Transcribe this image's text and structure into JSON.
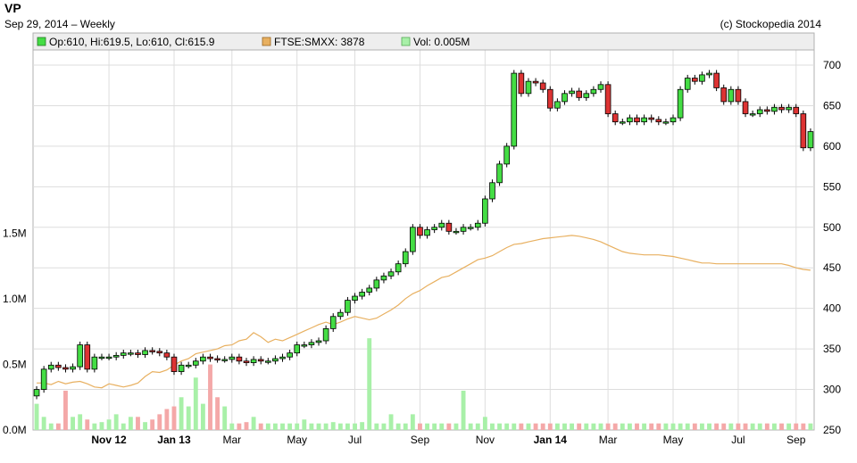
{
  "header": {
    "title": "VP",
    "subtitle": "Sep 29, 2014 – Weekly",
    "copyright": "(c) Stockopedia 2014"
  },
  "legend": {
    "ohlc": "Op:610, Hi:619.5, Lo:610, Cl:615.9",
    "index": "FTSE:SMXX: 3878",
    "volume": "Vol: 0.005M"
  },
  "colors": {
    "up": "#44dd44",
    "down": "#dd3333",
    "index_line": "#e8b060",
    "vol_up": "#a8f0a8",
    "vol_down": "#f4a8a8",
    "grid": "#dddddd",
    "legend_bg": "#eeeeee"
  },
  "chart_data": {
    "type": "candlestick",
    "price_axis": {
      "ylim": [
        250,
        700
      ],
      "ticks": [
        700,
        650,
        600,
        550,
        500,
        450,
        400,
        350,
        300,
        250
      ]
    },
    "volume_axis": {
      "ylim": [
        0,
        2.9
      ],
      "ticks": [
        {
          "value": 1.5,
          "label": "1.5M"
        },
        {
          "value": 1.0,
          "label": "1.0M"
        },
        {
          "value": 0.5,
          "label": "0.5M"
        },
        {
          "value": 0.0,
          "label": "0.0M"
        }
      ]
    },
    "x_ticks": [
      {
        "index": 10,
        "label": "Nov 12",
        "bold": true
      },
      {
        "index": 19,
        "label": "Jan 13",
        "bold": true
      },
      {
        "index": 27,
        "label": "Mar",
        "bold": false
      },
      {
        "index": 36,
        "label": "May",
        "bold": false
      },
      {
        "index": 44,
        "label": "Jul",
        "bold": false
      },
      {
        "index": 53,
        "label": "Sep",
        "bold": false
      },
      {
        "index": 62,
        "label": "Nov",
        "bold": false
      },
      {
        "index": 71,
        "label": "Jan 14",
        "bold": true
      },
      {
        "index": 79,
        "label": "Mar",
        "bold": false
      },
      {
        "index": 88,
        "label": "May",
        "bold": false
      },
      {
        "index": 97,
        "label": "Jul",
        "bold": false
      },
      {
        "index": 105,
        "label": "Sep",
        "bold": false
      }
    ],
    "closes": [
      300,
      325,
      330,
      327,
      325,
      328,
      355,
      325,
      340,
      340,
      340,
      342,
      345,
      345,
      343,
      348,
      347,
      345,
      340,
      322,
      330,
      330,
      335,
      340,
      338,
      337,
      337,
      340,
      335,
      333,
      337,
      335,
      335,
      338,
      340,
      345,
      355,
      355,
      358,
      360,
      375,
      390,
      395,
      410,
      415,
      420,
      425,
      435,
      440,
      445,
      455,
      470,
      500,
      490,
      497,
      500,
      505,
      495,
      495,
      500,
      500,
      505,
      535,
      555,
      578,
      600,
      690,
      665,
      680,
      678,
      670,
      647,
      655,
      665,
      668,
      660,
      665,
      670,
      676,
      640,
      630,
      630,
      635,
      630,
      635,
      633,
      630,
      630,
      635,
      670,
      684,
      680,
      688,
      690,
      672,
      655,
      670,
      655,
      640,
      640,
      645,
      643,
      648,
      645,
      648,
      640,
      598,
      618
    ],
    "index_line": [
      308,
      308,
      306,
      310,
      307,
      309,
      310,
      307,
      303,
      302,
      307,
      305,
      303,
      305,
      308,
      316,
      322,
      321,
      324,
      330,
      335,
      338,
      344,
      346,
      348,
      350,
      354,
      355,
      360,
      362,
      370,
      365,
      358,
      362,
      360,
      364,
      368,
      372,
      376,
      380,
      383,
      380,
      383,
      387,
      390,
      388,
      386,
      388,
      393,
      398,
      404,
      412,
      418,
      422,
      428,
      433,
      438,
      440,
      445,
      450,
      455,
      460,
      462,
      465,
      470,
      475,
      479,
      480,
      482,
      484,
      486,
      487,
      488,
      489,
      490,
      489,
      487,
      485,
      482,
      478,
      474,
      470,
      468,
      467,
      466,
      466,
      466,
      465,
      464,
      462,
      460,
      458,
      456,
      456,
      455,
      455,
      455,
      455,
      455,
      455,
      455,
      455,
      455,
      455,
      453,
      450,
      448,
      447
    ],
    "volume": [
      0.2,
      0.1,
      0.05,
      0.05,
      0.3,
      0.1,
      0.12,
      0.08,
      0.05,
      0.06,
      0.08,
      0.12,
      0.05,
      0.1,
      0.1,
      0.06,
      0.08,
      0.12,
      0.16,
      0.18,
      0.25,
      0.18,
      0.4,
      0.2,
      0.5,
      0.25,
      0.18,
      0.05,
      0.05,
      0.06,
      0.1,
      0.05,
      0.05,
      0.05,
      0.05,
      0.05,
      0.05,
      0.08,
      0.05,
      0.05,
      0.05,
      0.06,
      0.05,
      0.05,
      0.05,
      0.06,
      0.7,
      0.05,
      0.05,
      0.12,
      0.05,
      0.05,
      0.12,
      0.05,
      0.05,
      0.05,
      0.05,
      0.05,
      0.05,
      0.3,
      0.05,
      0.05,
      0.1,
      0.05,
      0.05,
      0.05,
      0.05,
      0.05,
      0.05,
      0.05,
      0.05,
      0.05,
      0.05,
      0.05,
      0.05,
      0.05,
      0.05,
      0.05,
      0.05,
      0.05,
      0.05,
      0.05,
      0.05,
      0.05,
      0.05,
      0.05,
      0.05,
      0.05,
      0.05,
      0.05,
      0.05,
      0.05,
      0.05,
      0.05,
      0.05,
      0.05,
      0.05,
      0.05,
      0.05,
      0.05,
      0.05,
      0.05,
      0.05,
      0.05,
      0.05,
      0.05,
      0.05,
      0.05
    ]
  }
}
